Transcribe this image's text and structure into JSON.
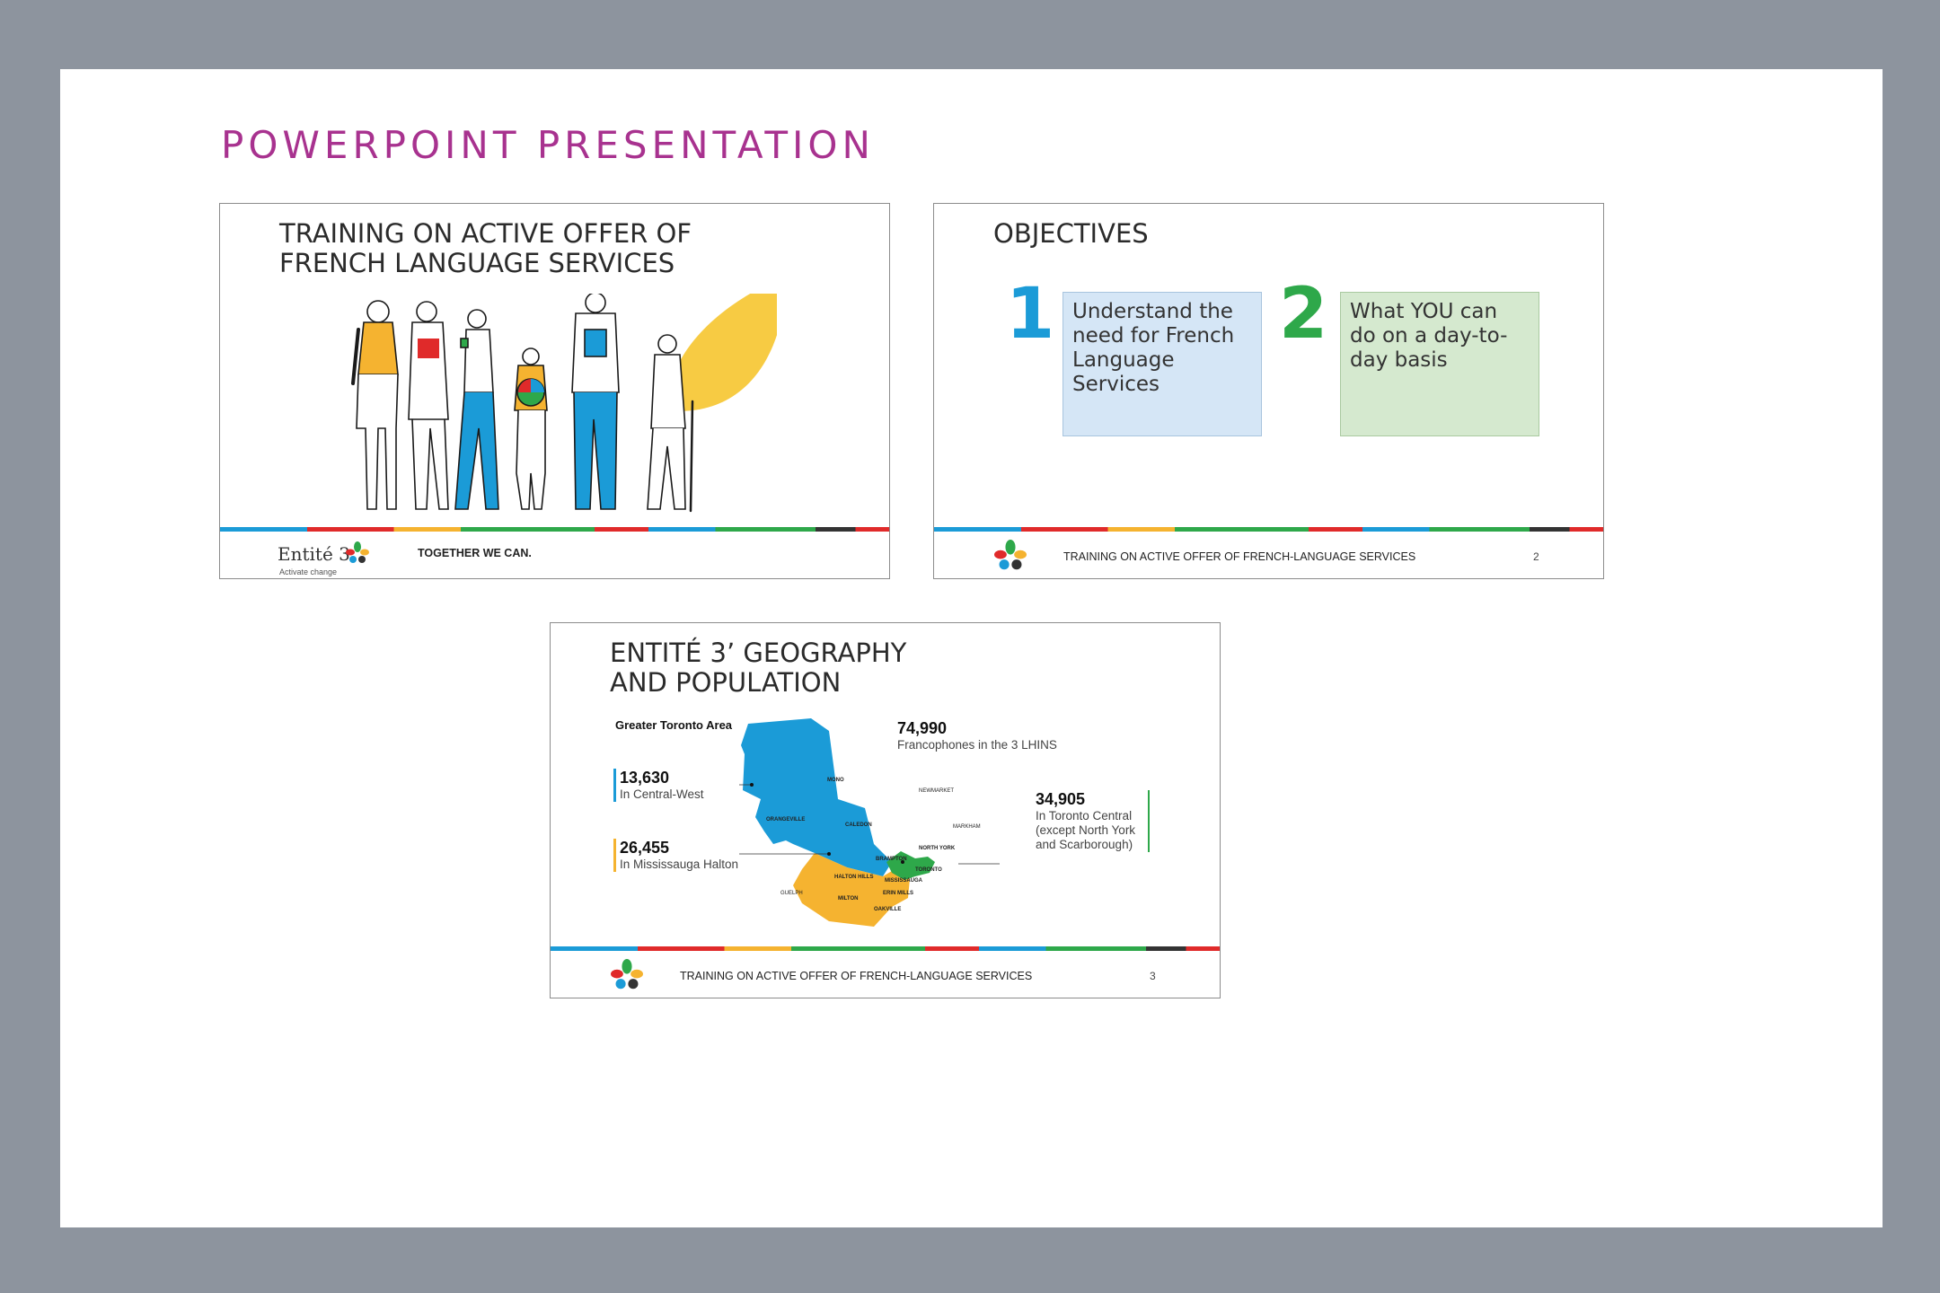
{
  "heading": "POWERPOINT PRESENTATION",
  "brand": {
    "colors": {
      "blue": "#1b9bd7",
      "red": "#e02a2a",
      "yellow": "#f5b330",
      "green": "#2ea84a",
      "magenta": "#a8328f"
    }
  },
  "slides": [
    {
      "title": "TRAINING ON ACTIVE OFFER OF\nFRENCH LANGUAGE SERVICES",
      "logo_text": "Entité 3",
      "tagline": "Activate change",
      "footer_text": "TOGETHER WE CAN.",
      "illustration": "people-illustration"
    },
    {
      "title": "OBJECTIVES",
      "objectives": [
        {
          "number": "1",
          "text": "Understand the need for French Language Services"
        },
        {
          "number": "2",
          "text": "What YOU can do on a day-to-day basis"
        }
      ],
      "footer_text": "TRAINING ON ACTIVE OFFER OF FRENCH-LANGUAGE SERVICES",
      "page_number": "2"
    },
    {
      "title": "ENTITÉ 3’ GEOGRAPHY\nAND POPULATION",
      "map_title": "Greater Toronto Area",
      "stats": [
        {
          "value": "74,990",
          "label": "Francophones in the 3 LHINS"
        },
        {
          "value": "13,630",
          "label": "In Central-West"
        },
        {
          "value": "26,455",
          "label": "In Mississauga Halton"
        },
        {
          "value": "34,905",
          "label": "In Toronto Central\n(except North York\nand Scarborough)"
        }
      ],
      "map_labels": [
        "MONO",
        "ORANGEVILLE",
        "CALEDON",
        "BRAMPTON",
        "NEWMARKET",
        "MARKHAM",
        "NORTH YORK",
        "TORONTO",
        "HALTON HILLS",
        "MISSISSAUGA",
        "ERIN MILLS",
        "MILTON",
        "OAKVILLE",
        "GUELPH"
      ],
      "footer_text": "TRAINING ON ACTIVE OFFER OF FRENCH-LANGUAGE SERVICES",
      "page_number": "3"
    }
  ]
}
